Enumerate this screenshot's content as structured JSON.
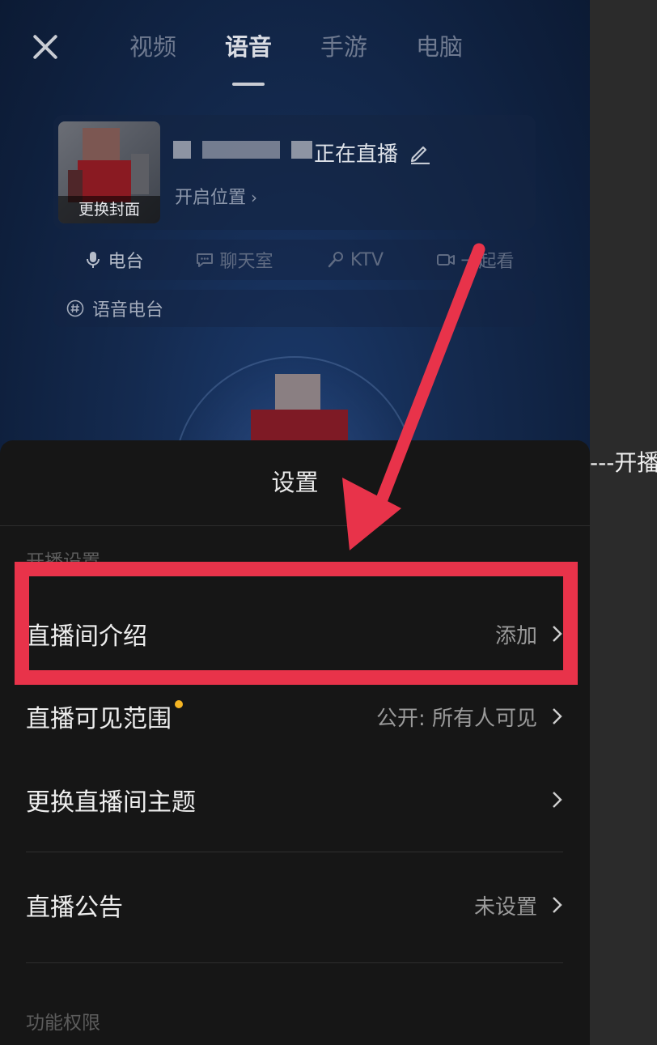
{
  "header": {
    "tabs": [
      {
        "label": "视频",
        "active": false
      },
      {
        "label": "语音",
        "active": true
      },
      {
        "label": "手游",
        "active": false
      },
      {
        "label": "电脑",
        "active": false
      }
    ]
  },
  "live_card": {
    "cover_label": "更换封面",
    "title_suffix": "正在直播",
    "location": "开启位置",
    "location_chevron": "›"
  },
  "types": [
    {
      "label": "电台",
      "icon": "microphone-icon",
      "active": true
    },
    {
      "label": "聊天室",
      "icon": "chat-bubble-icon",
      "active": false
    },
    {
      "label": "KTV",
      "icon": "mic-ktv-icon",
      "active": false
    },
    {
      "label": "一起看",
      "icon": "video-icon",
      "active": false
    }
  ],
  "topic": {
    "label": "语音电台",
    "icon": "hashtag-icon"
  },
  "settings": {
    "title": "设置",
    "section_broadcast": "开播设置",
    "rows": [
      {
        "label": "直播间介绍",
        "value": "添加",
        "new_dot": false
      },
      {
        "label": "直播可见范围",
        "value": "公开: 所有人可见",
        "new_dot": true
      },
      {
        "label": "更换直播间主题",
        "value": "",
        "new_dot": false
      },
      {
        "label": "直播公告",
        "value": "未设置",
        "new_dot": false
      }
    ],
    "section_permissions": "功能权限"
  },
  "annotation": {
    "side_caption": "---开播",
    "color": "#e8334a"
  }
}
